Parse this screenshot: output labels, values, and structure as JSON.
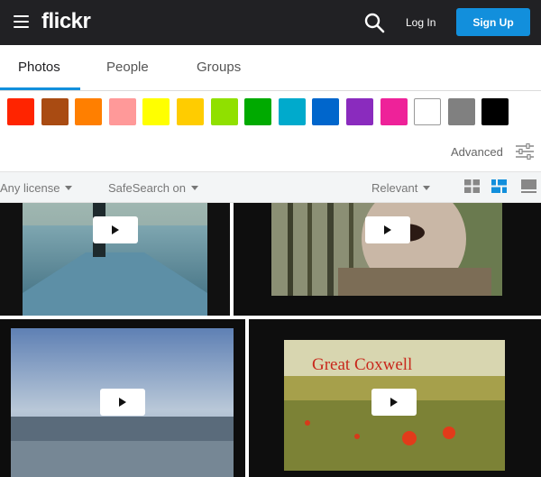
{
  "header": {
    "logo": "flickr",
    "login_label": "Log In",
    "signup_label": "Sign Up"
  },
  "tabs": [
    {
      "label": "Photos",
      "active": true
    },
    {
      "label": "People",
      "active": false
    },
    {
      "label": "Groups",
      "active": false
    }
  ],
  "color_swatches": [
    "#ff2400",
    "#a94b12",
    "#ff7f00",
    "#ff9999",
    "#ffff00",
    "#ffcc00",
    "#90e000",
    "#00aa00",
    "#00aacc",
    "#0066cc",
    "#8a2bbe",
    "#ee2299",
    "#ffffff",
    "#808080",
    "#000000"
  ],
  "advanced_label": "Advanced",
  "filters": {
    "license": "Any license",
    "safesearch": "SafeSearch on",
    "sort": "Relevant"
  },
  "videos": [
    {
      "title_overlay": ""
    },
    {
      "title_overlay": ""
    },
    {
      "title_overlay": ""
    },
    {
      "title_overlay": "Great Coxwell"
    }
  ],
  "colors": {
    "topbar": "#212124",
    "accent": "#128fdc"
  }
}
